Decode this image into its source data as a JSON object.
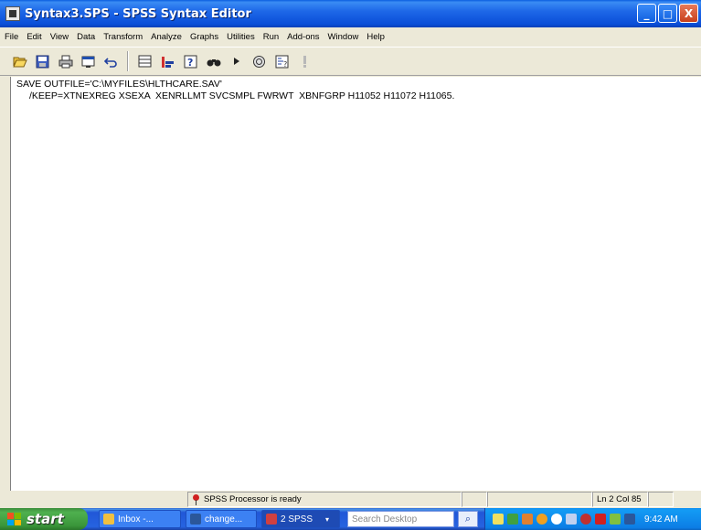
{
  "window": {
    "title": "Syntax3.SPS - SPSS Syntax Editor",
    "controls": {
      "minimize": "_",
      "maximize": "□",
      "close": "X"
    }
  },
  "menu": [
    "File",
    "Edit",
    "View",
    "Data",
    "Transform",
    "Analyze",
    "Graphs",
    "Utilities",
    "Run",
    "Add-ons",
    "Window",
    "Help"
  ],
  "toolbar": {
    "buttons": [
      "open-icon",
      "save-icon",
      "print-icon",
      "dialog-recall-icon",
      "undo-icon",
      "goto-case-icon",
      "variables-icon",
      "help-icon",
      "find-icon",
      "run-icon",
      "stop-icon",
      "syntax-help-icon",
      "execute-icon"
    ]
  },
  "editor": {
    "line1": "SAVE OUTFILE='C:\\MYFILES\\HLTHCARE.SAV'",
    "line2": "/KEEP=XTNEXREG XSEXA  XENRLLMT SVCSMPL FWRWT  XBNFGRP H11052 H11072 H11065."
  },
  "status": {
    "processor": "SPSS Processor  is ready",
    "position": "Ln 2 Col 85"
  },
  "taskbar": {
    "start": "start",
    "tasks": [
      "Inbox -...",
      "change...",
      "2 SPSS"
    ],
    "search_placeholder": "Search Desktop",
    "clock": "9:42 AM"
  }
}
